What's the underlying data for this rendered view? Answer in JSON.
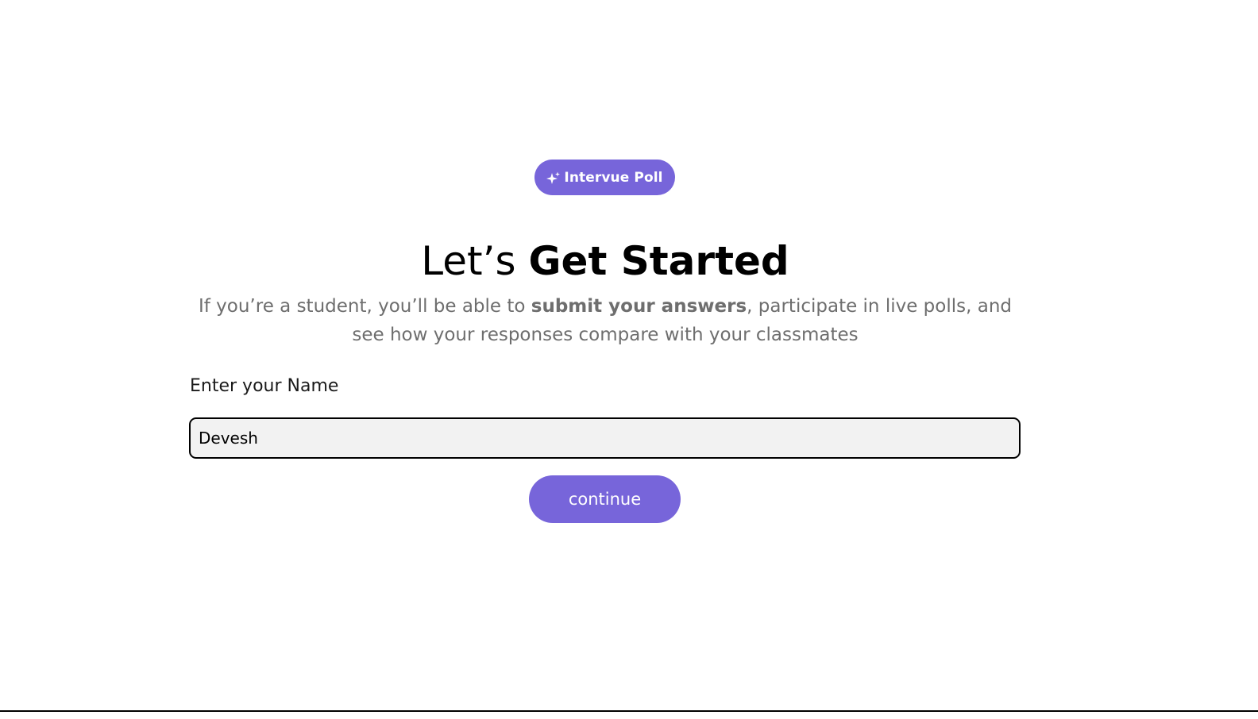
{
  "badge": {
    "icon": "sparkle-icon",
    "label": "Intervue Poll"
  },
  "heading": {
    "light": "Let’s",
    "bold": "Get Started"
  },
  "subtitle": {
    "before": "If you’re a student, you’ll be able to ",
    "emphasis": "submit your answers",
    "after": ", participate in live polls, and see how your responses compare with your classmates"
  },
  "form": {
    "name_label": "Enter your Name",
    "name_value": "Devesh"
  },
  "actions": {
    "continue_label": "continue"
  },
  "colors": {
    "accent": "#7765DA",
    "subtitle_text": "#6E6E6E",
    "input_bg": "#F2F2F2"
  }
}
